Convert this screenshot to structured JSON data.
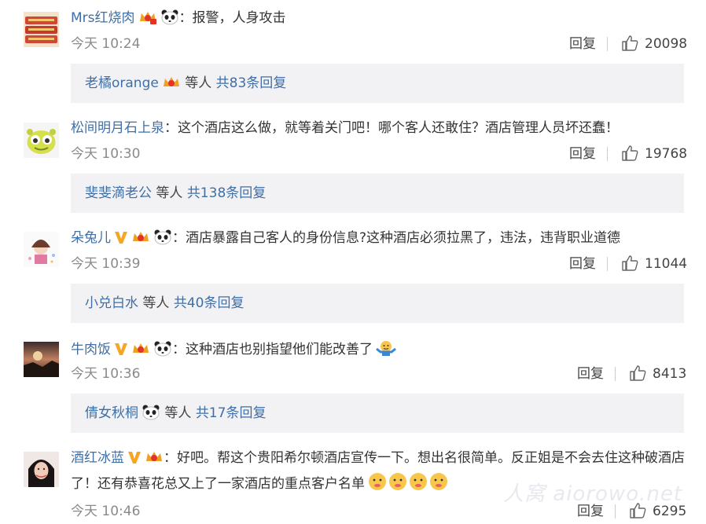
{
  "comments": [
    {
      "username": "Mrs红烧肉",
      "text": "：报警，人身攻击",
      "time": "今天 10:24",
      "reply_label": "回复",
      "likes": "20098",
      "sub": {
        "user": "老橘orange",
        "mid": "等人",
        "count": "共83条回复"
      }
    },
    {
      "username": "松间明月石上泉",
      "text": "：这个酒店这么做，就等着关门吧！哪个客人还敢住？酒店管理人员坏还蠢！",
      "time": "今天 10:30",
      "reply_label": "回复",
      "likes": "19768",
      "sub": {
        "user": "斐斐滴老公",
        "mid": "等人",
        "count": "共138条回复"
      }
    },
    {
      "username": "朵兔儿",
      "text": "：酒店暴露自己客人的身份信息?这种酒店必须拉黑了，违法，违背职业道德",
      "time": "今天 10:39",
      "reply_label": "回复",
      "likes": "11044",
      "sub": {
        "user": "小兑白水",
        "mid": "等人",
        "count": "共40条回复"
      }
    },
    {
      "username": "牛肉饭",
      "text": "：这种酒店也别指望他们能改善了",
      "time": "今天 10:36",
      "reply_label": "回复",
      "likes": "8413",
      "sub": {
        "user": "倩女秋桐",
        "mid": "等人",
        "count": "共17条回复"
      }
    },
    {
      "username": "酒红冰蓝",
      "text": "：好吧。帮这个贵阳希尔顿酒店宣传一下。想出名很简单。反正姐是不会去住这种破酒店了！还有恭喜花总又上了一家酒店的重点客户名单",
      "time": "今天 10:46",
      "reply_label": "回复",
      "likes": "6295"
    }
  ],
  "watermark": "人窝 aiorowo.net",
  "colors": {
    "username": "#3f6fa5",
    "subbox_bg": "#f2f2f5",
    "time": "#8a8a8a"
  }
}
